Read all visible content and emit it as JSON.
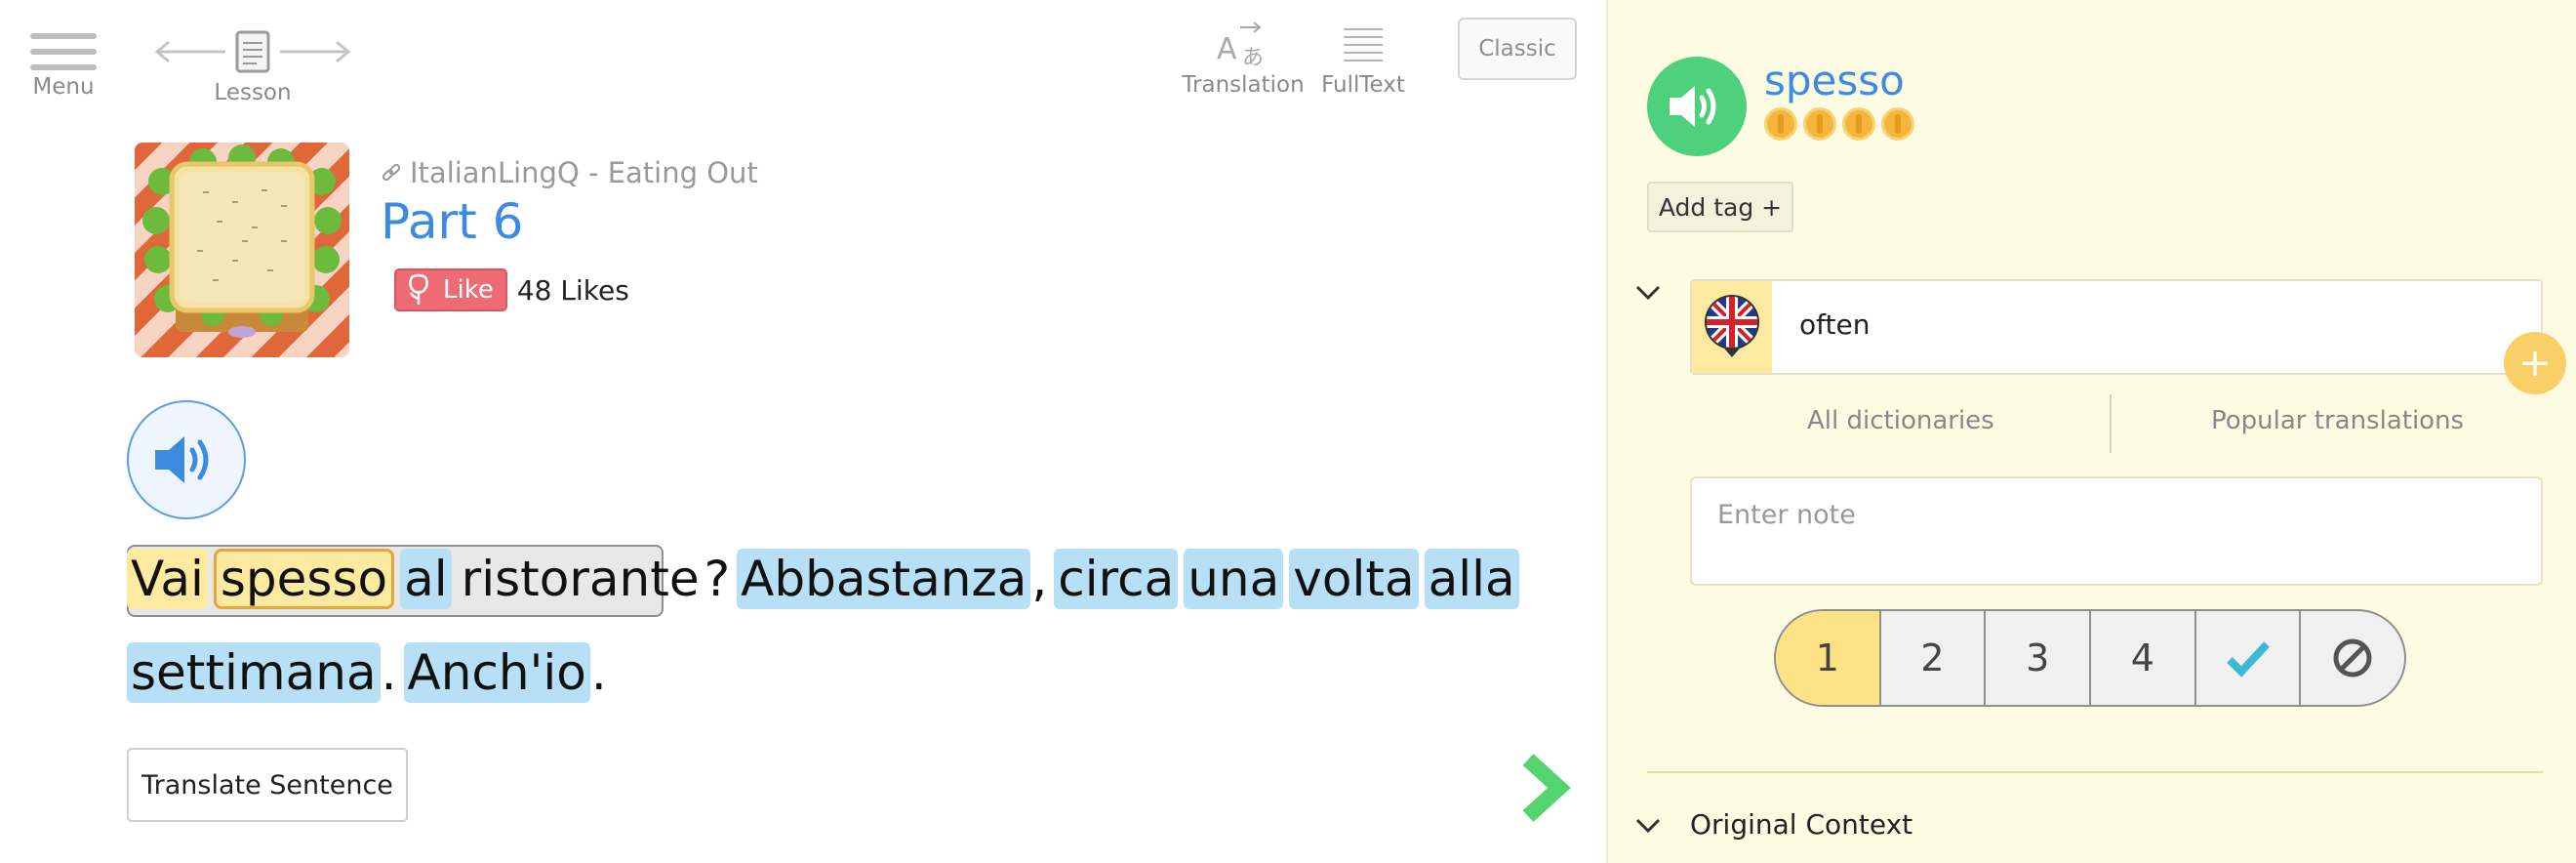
{
  "toolbar": {
    "menu_label": "Menu",
    "lesson_label": "Lesson",
    "translation_label": "Translation",
    "fulltext_label": "FullText",
    "classic_label": "Classic"
  },
  "lesson": {
    "course": "ItalianLingQ - Eating Out",
    "title": "Part 6",
    "like_label": "Like",
    "likes_count": "48 Likes"
  },
  "reader": {
    "line1": [
      {
        "text": "Vai",
        "style": "yellow"
      },
      {
        "text": "spesso",
        "style": "sel"
      },
      {
        "text": "al",
        "style": "blue"
      },
      {
        "text": "ristorante",
        "style": "plain"
      },
      {
        "text": "?",
        "style": "punct"
      },
      {
        "text": "Abbastanza",
        "style": "blue"
      },
      {
        "text": ",",
        "style": "punct"
      },
      {
        "text": "circa",
        "style": "blue"
      },
      {
        "text": "una",
        "style": "blue"
      },
      {
        "text": "volta",
        "style": "blue"
      },
      {
        "text": "alla",
        "style": "blue"
      }
    ],
    "line2": [
      {
        "text": "settimana",
        "style": "blue"
      },
      {
        "text": ".",
        "style": "punct"
      },
      {
        "text": "Anch'io",
        "style": "blue"
      },
      {
        "text": ".",
        "style": "punct"
      }
    ],
    "translate_button": "Translate Sentence"
  },
  "sidebar": {
    "term": "spesso",
    "add_tag": "Add tag +",
    "meaning": "often",
    "dict_all": "All dictionaries",
    "dict_popular": "Popular translations",
    "note_placeholder": "Enter note",
    "status_options": [
      "1",
      "2",
      "3",
      "4"
    ],
    "status_active": "1",
    "original_context": "Original Context"
  },
  "colors": {
    "accent_blue": "#3d8be0",
    "known_blue": "#b7e0f6",
    "lingq_yellow": "#fde9a0",
    "sidebar_bg": "#fefbe3",
    "audio_green": "#4dd17c",
    "like_red": "#ef6b74"
  },
  "icons": [
    "hamburger-icon",
    "back-arrow-icon",
    "lesson-doc-icon",
    "forward-arrow-icon",
    "translation-icon",
    "fulltext-icon",
    "link-icon",
    "rose-icon",
    "speaker-icon",
    "uk-flag-icon",
    "chevron-down-icon",
    "plus-icon",
    "checkmark-icon",
    "ignore-icon",
    "next-arrow-icon"
  ]
}
